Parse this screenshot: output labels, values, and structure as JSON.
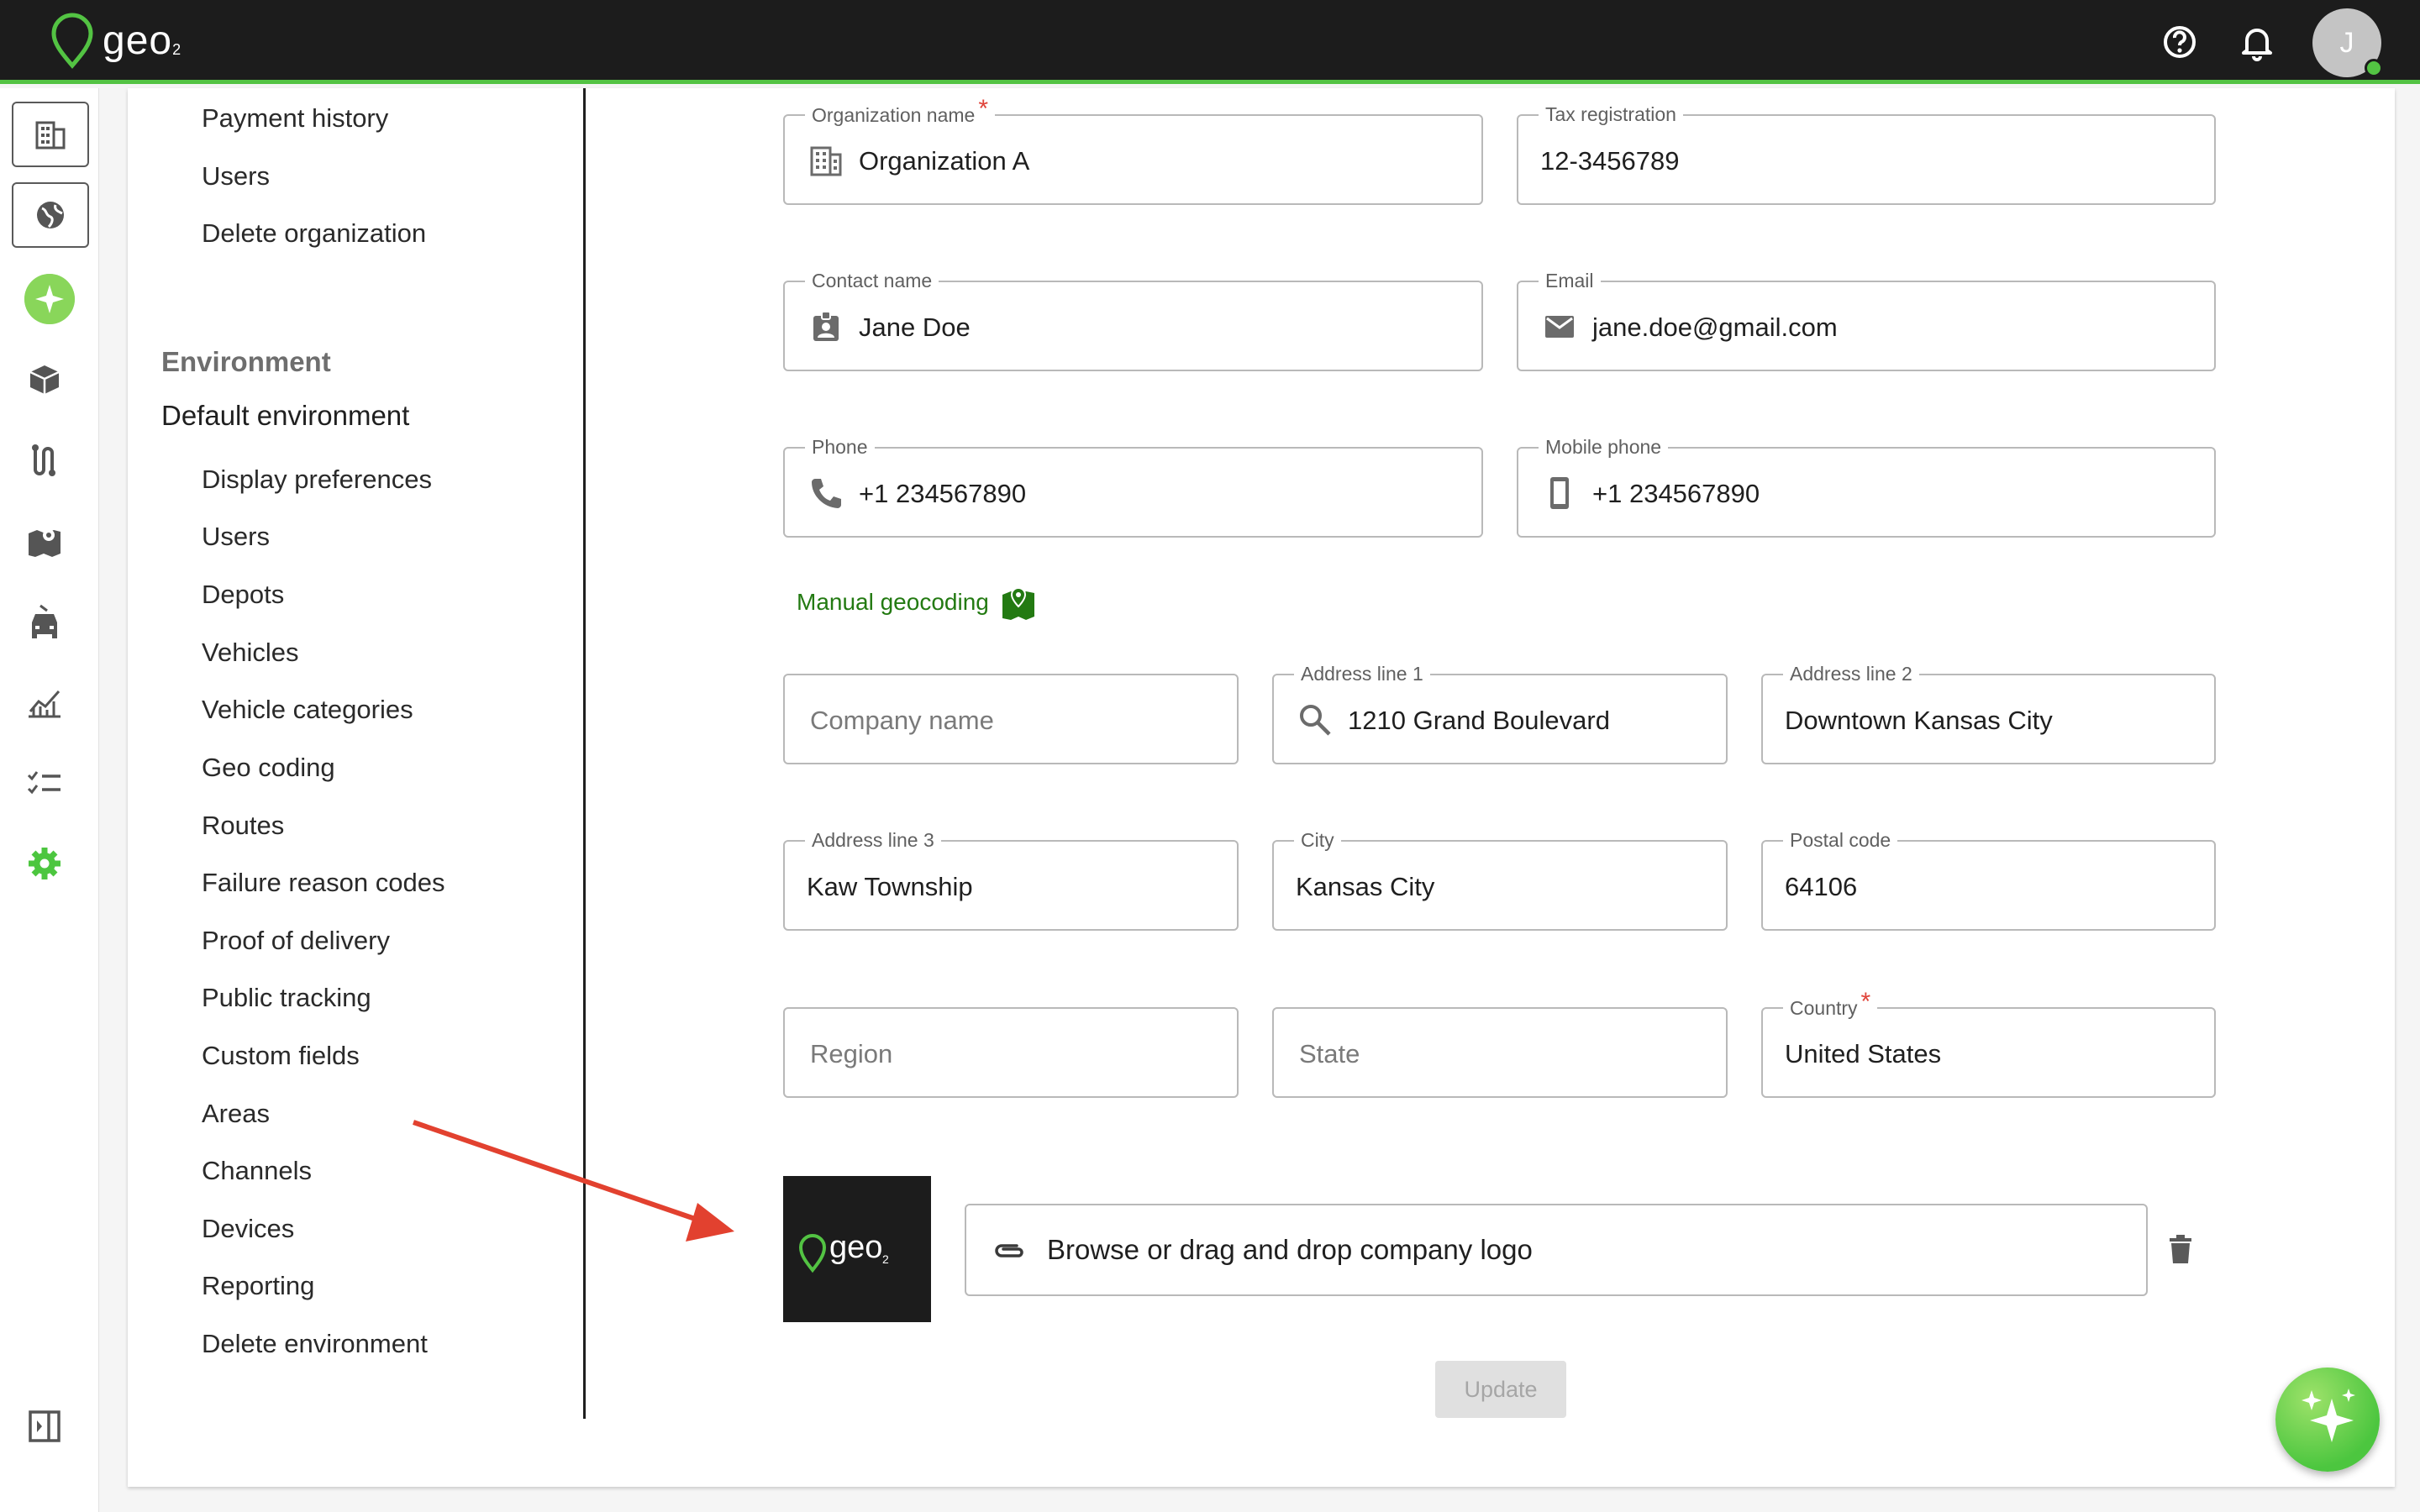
{
  "app": {
    "logo_text": "geo",
    "logo_sub": "2",
    "avatar_initial": "J"
  },
  "colors": {
    "brand": "#53c343",
    "link": "#237a12",
    "required": "#e0443a"
  },
  "settings_nav": {
    "org_items": [
      "Payment history",
      "Users",
      "Delete organization"
    ],
    "environment_heading": "Environment",
    "environment_name": "Default environment",
    "env_items": [
      "Display preferences",
      "Users",
      "Depots",
      "Vehicles",
      "Vehicle categories",
      "Geo coding",
      "Routes",
      "Failure reason codes",
      "Proof of delivery",
      "Public tracking",
      "Custom fields",
      "Areas",
      "Channels",
      "Devices",
      "Reporting",
      "Delete environment"
    ]
  },
  "form": {
    "org_name": {
      "label": "Organization name",
      "value": "Organization A",
      "required": "*"
    },
    "tax": {
      "label": "Tax registration",
      "value": "12-3456789"
    },
    "contact": {
      "label": "Contact name",
      "value": "Jane Doe"
    },
    "email": {
      "label": "Email",
      "value": "jane.doe@gmail.com"
    },
    "phone": {
      "label": "Phone",
      "value": "+1 234567890"
    },
    "mobile": {
      "label": "Mobile phone",
      "value": "+1 234567890"
    },
    "manual_geocoding": "Manual geocoding",
    "company": {
      "placeholder": "Company name"
    },
    "address1": {
      "label": "Address line 1",
      "value": "1210 Grand Boulevard"
    },
    "address2": {
      "label": "Address line 2",
      "value": "Downtown Kansas City"
    },
    "address3": {
      "label": "Address line 3",
      "value": "Kaw Township"
    },
    "city": {
      "label": "City",
      "value": "Kansas City"
    },
    "postal": {
      "label": "Postal code",
      "value": "64106"
    },
    "region": {
      "placeholder": "Region"
    },
    "state": {
      "placeholder": "State"
    },
    "country": {
      "label": "Country",
      "value": "United States",
      "required": "*"
    },
    "upload_text": "Browse or drag and drop company logo",
    "update_label": "Update"
  }
}
